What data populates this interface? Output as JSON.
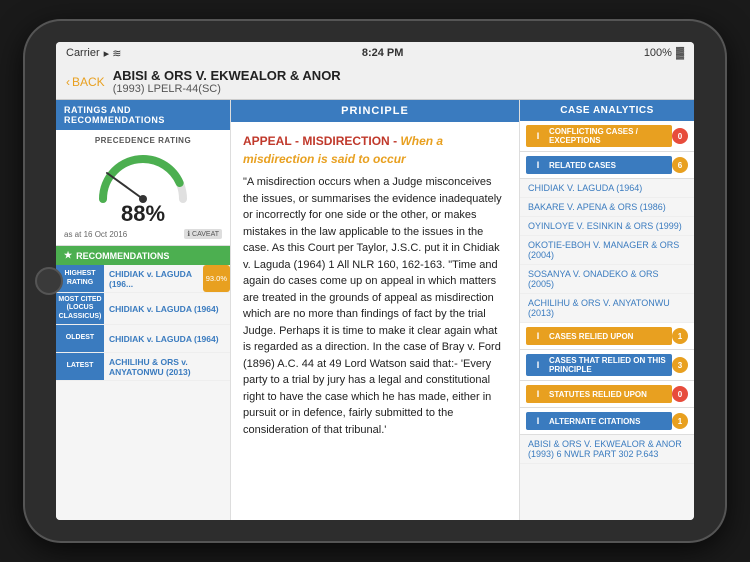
{
  "device": {
    "status_bar": {
      "carrier": "Carrier",
      "wifi_icon": "wifi",
      "time": "8:24 PM",
      "battery": "100%"
    }
  },
  "header": {
    "back_label": "BACK",
    "title": "ABISI & ORS V. EKWEALOR & ANOR",
    "subtitle": "(1993) LPELR-44(SC)"
  },
  "left_panel": {
    "section_title": "RATINGS AND RECOMMENDATIONS",
    "precedence": {
      "label": "PRECEDENCE RATING",
      "value": "88%",
      "date": "as at 16 Oct 2016",
      "caveat": "CAVEAT"
    },
    "recommendations_title": "RECOMMENDATIONS",
    "recommendations": [
      {
        "label": "HIGHEST RATING",
        "case_name": "CHIDIAK v. LAGUDA (196...",
        "badge": "93.0%"
      },
      {
        "label": "MOST CITED (LOCUS CLASSICUS)",
        "case_name": "CHIDIAK v. LAGUDA (1964)",
        "badge": null
      },
      {
        "label": "OLDEST",
        "case_name": "CHIDIAK v. LAGUDA (1964)",
        "badge": null
      },
      {
        "label": "LATEST",
        "case_name": "ACHILIHU & ORS v. ANYATONWU (2013)",
        "badge": null
      }
    ]
  },
  "middle_panel": {
    "section_title": "PRINCIPLE",
    "headline_bold1": "APPEAL",
    "headline_sep1": " - ",
    "headline_bold2": "MISDIRECTION",
    "headline_sep2": " - ",
    "headline_italic": "When a misdirection is said to occur",
    "body_text": "\"A misdirection occurs when a Judge misconceives the issues, or summarises the evidence inadequately or incorrectly for one side or the other, or makes mistakes in the law applicable to the issues in the case. As this Court per Taylor, J.S.C. put it in Chidiak v. Laguda (1964) 1 All NLR 160, 162-163. \"Time and again do cases come up on appeal in which matters are treated in the grounds of appeal as misdirection which are no more than findings of fact by the trial Judge. Perhaps it is time to make it clear again what is regarded as a direction. In the case of Bray v. Ford (1896) A.C. 44 at 49 Lord Watson said that:- 'Every party to a trial by jury has a legal and constitutional right to have the case which he has made, either in pursuit or in defence, fairly submitted to the consideration of that tribunal.'"
  },
  "right_panel": {
    "section_title": "CASE ANALYTICS",
    "items": [
      {
        "label": "CONFLICTING CASES / EXCEPTIONS",
        "count": "0",
        "count_color": "red",
        "icon_color": "orange"
      },
      {
        "label": "RELATED CASES",
        "count": "6",
        "count_color": "orange",
        "icon_color": "blue"
      }
    ],
    "related_cases": [
      "CHIDIAK V. LAGUDA (1964)",
      "BAKARE V. APENA & ORS (1986)",
      "OYINLOYE V. ESINKIN & ORS (1999)",
      "OKOTIE-EBOH V. MANAGER & ORS (2004)",
      "SOSANYA V. ONADEKO & ORS (2005)",
      "ACHILIHU & ORS V. ANYATONWU (2013)"
    ],
    "secondary_items": [
      {
        "label": "CASES RELIED UPON",
        "count": "1",
        "count_color": "orange",
        "icon_color": "orange"
      },
      {
        "label": "CASES THAT RELIED ON THIS PRINCIPLE",
        "count": "3",
        "count_color": "orange",
        "icon_color": "blue"
      },
      {
        "label": "STATUTES RELIED UPON",
        "count": "0",
        "count_color": "red",
        "icon_color": "orange"
      },
      {
        "label": "ALTERNATE CITATIONS",
        "count": "1",
        "count_color": "orange",
        "icon_color": "blue"
      }
    ],
    "alternate_citation": "ABISI & ORS V. EKWEALOR & ANOR (1993) 6 NWLR PART 302 P.643"
  }
}
